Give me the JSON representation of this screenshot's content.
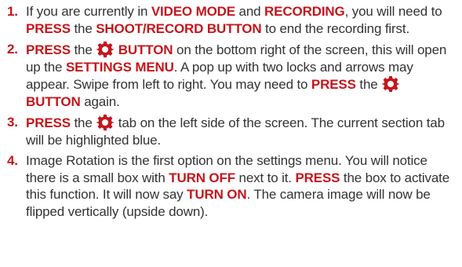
{
  "accent_color": "#c4161c",
  "text_color": "#333333",
  "steps": [
    {
      "number": "1.",
      "parts": [
        {
          "t": "text",
          "v": "If you are currently in "
        },
        {
          "t": "em",
          "v": "VIDEO MODE"
        },
        {
          "t": "text",
          "v": " and "
        },
        {
          "t": "em",
          "v": "RECORDING"
        },
        {
          "t": "text",
          "v": ", you will need to "
        },
        {
          "t": "em",
          "v": "PRESS"
        },
        {
          "t": "text",
          "v": " the "
        },
        {
          "t": "em",
          "v": "SHOOT/RECORD BUTTON"
        },
        {
          "t": "text",
          "v": " to end the recording first."
        }
      ]
    },
    {
      "number": "2.",
      "parts": [
        {
          "t": "em",
          "v": "PRESS"
        },
        {
          "t": "text",
          "v": " the "
        },
        {
          "t": "icon",
          "v": "gear-icon"
        },
        {
          "t": "em",
          "v": " BUTTON"
        },
        {
          "t": "text",
          "v": " on the bottom right of the screen, this will open up the "
        },
        {
          "t": "em",
          "v": "SETTINGS MENU"
        },
        {
          "t": "text",
          "v": ". A pop up with two locks and arrows may appear. Swipe from left to right. You may need to "
        },
        {
          "t": "em",
          "v": "PRESS"
        },
        {
          "t": "text",
          "v": " the "
        },
        {
          "t": "icon",
          "v": "gear-icon"
        },
        {
          "t": "em",
          "v": " BUTTON"
        },
        {
          "t": "text",
          "v": " again."
        }
      ]
    },
    {
      "number": "3.",
      "parts": [
        {
          "t": "em",
          "v": "PRESS"
        },
        {
          "t": "text",
          "v": " the "
        },
        {
          "t": "icon",
          "v": "gear-icon"
        },
        {
          "t": "text",
          "v": " tab on the left side of the screen. The current section tab will be highlighted blue."
        }
      ]
    },
    {
      "number": "4.",
      "parts": [
        {
          "t": "text",
          "v": "Image Rotation is the first option on the settings menu. You will notice there is a small box with "
        },
        {
          "t": "em",
          "v": "TURN OFF"
        },
        {
          "t": "text",
          "v": " next to it. "
        },
        {
          "t": "em",
          "v": "PRESS"
        },
        {
          "t": "text",
          "v": " the box to activate this function. It will now say "
        },
        {
          "t": "em",
          "v": "TURN ON"
        },
        {
          "t": "text",
          "v": ". The camera image will now be flipped vertically (upside down)."
        }
      ]
    }
  ]
}
